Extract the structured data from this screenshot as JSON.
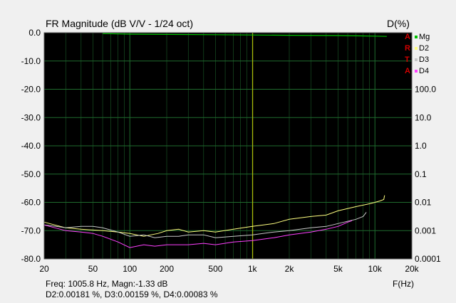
{
  "chart_data": {
    "type": "line",
    "title": "FR Magnitude (dB V/V - 1/24 oct)",
    "ylabel_right": "D(%)",
    "xlabel": "F(Hz)",
    "x_scale": "log",
    "xlim": [
      20,
      20000
    ],
    "ylim": [
      -80,
      0
    ],
    "x_ticks": [
      20,
      50,
      100,
      200,
      500,
      1000,
      2000,
      5000,
      10000,
      20000
    ],
    "x_tick_labels": [
      "20",
      "50",
      "100",
      "200",
      "500",
      "1k",
      "2k",
      "5k",
      "10k",
      "20k"
    ],
    "y_ticks": [
      0,
      -10,
      -20,
      -30,
      -40,
      -50,
      -60,
      -70,
      -80
    ],
    "y_tick_labels": [
      "0.0",
      "-10.0",
      "-20.0",
      "-30.0",
      "-40.0",
      "-50.0",
      "-60.0",
      "-70.0",
      "-80.0"
    ],
    "right_ticks": [
      {
        "label": "100.0",
        "y": -20
      },
      {
        "label": "10.0",
        "y": -30
      },
      {
        "label": "1.0",
        "y": -40
      },
      {
        "label": "0.1",
        "y": -50
      },
      {
        "label": "0.01",
        "y": -60
      },
      {
        "label": "0.001",
        "y": -70
      },
      {
        "label": "0.0001",
        "y": -80
      }
    ],
    "background": "#000000",
    "grid_color": "#1f6b2e",
    "grid": true,
    "cursor_x": 1005.8,
    "cursor_color": "#c8c800",
    "series": [
      {
        "name": "Mg",
        "color": "#00c000",
        "x": [
          60,
          100,
          200,
          500,
          1000,
          2000,
          5000,
          10000,
          12500
        ],
        "y": [
          -0.3,
          -0.5,
          -0.6,
          -0.7,
          -0.8,
          -0.9,
          -1.0,
          -1.2,
          -1.3
        ]
      },
      {
        "name": "D2",
        "color": "#ffff80",
        "x": [
          20,
          30,
          40,
          60,
          80,
          100,
          130,
          170,
          200,
          250,
          300,
          400,
          500,
          700,
          1000,
          1500,
          2000,
          3000,
          4000,
          5000,
          7000,
          9000,
          10000,
          11000,
          11800,
          12000
        ],
        "y": [
          -67,
          -69,
          -69.5,
          -70,
          -70.5,
          -71,
          -72,
          -71,
          -70,
          -69.5,
          -70.5,
          -70,
          -70.5,
          -69.5,
          -68.5,
          -67.5,
          -66,
          -65,
          -64.5,
          -63,
          -61.5,
          -60.5,
          -60,
          -59.5,
          -59,
          -57.5
        ]
      },
      {
        "name": "D3",
        "color": "#c8c8c8",
        "x": [
          20,
          25,
          30,
          40,
          50,
          60,
          80,
          100,
          130,
          160,
          200,
          250,
          300,
          400,
          500,
          700,
          1000,
          1500,
          2000,
          3000,
          4000,
          5000,
          7000,
          8000,
          8500
        ],
        "y": [
          -68,
          -68.5,
          -69,
          -68.5,
          -68.5,
          -69,
          -70.5,
          -72,
          -71.5,
          -72.5,
          -72,
          -72,
          -71.5,
          -71.5,
          -72.5,
          -72,
          -71.5,
          -70.5,
          -70,
          -69,
          -68.5,
          -67.5,
          -66,
          -65,
          -63.5
        ]
      },
      {
        "name": "D4",
        "color": "#ff40ff",
        "x": [
          20,
          30,
          40,
          50,
          60,
          80,
          100,
          130,
          160,
          200,
          250,
          300,
          400,
          500,
          700,
          1000,
          1500,
          2000,
          3000,
          4000,
          5000,
          6000,
          6500
        ],
        "y": [
          -68,
          -70,
          -70.5,
          -71,
          -72,
          -74,
          -76,
          -75,
          -75.5,
          -75,
          -75,
          -75,
          -74.5,
          -75,
          -74,
          -73.5,
          -72.5,
          -71.5,
          -70.5,
          -69.5,
          -68.5,
          -67,
          -66.5
        ]
      }
    ]
  },
  "readout": {
    "line1": "Freq: 1005.8 Hz, Magn:-1.33 dB",
    "line2": "D2:0.00181 %, D3:0.00159 %, D4:0.00083 %"
  },
  "side_marker": {
    "text": "ARTA",
    "color": "#d00000"
  }
}
